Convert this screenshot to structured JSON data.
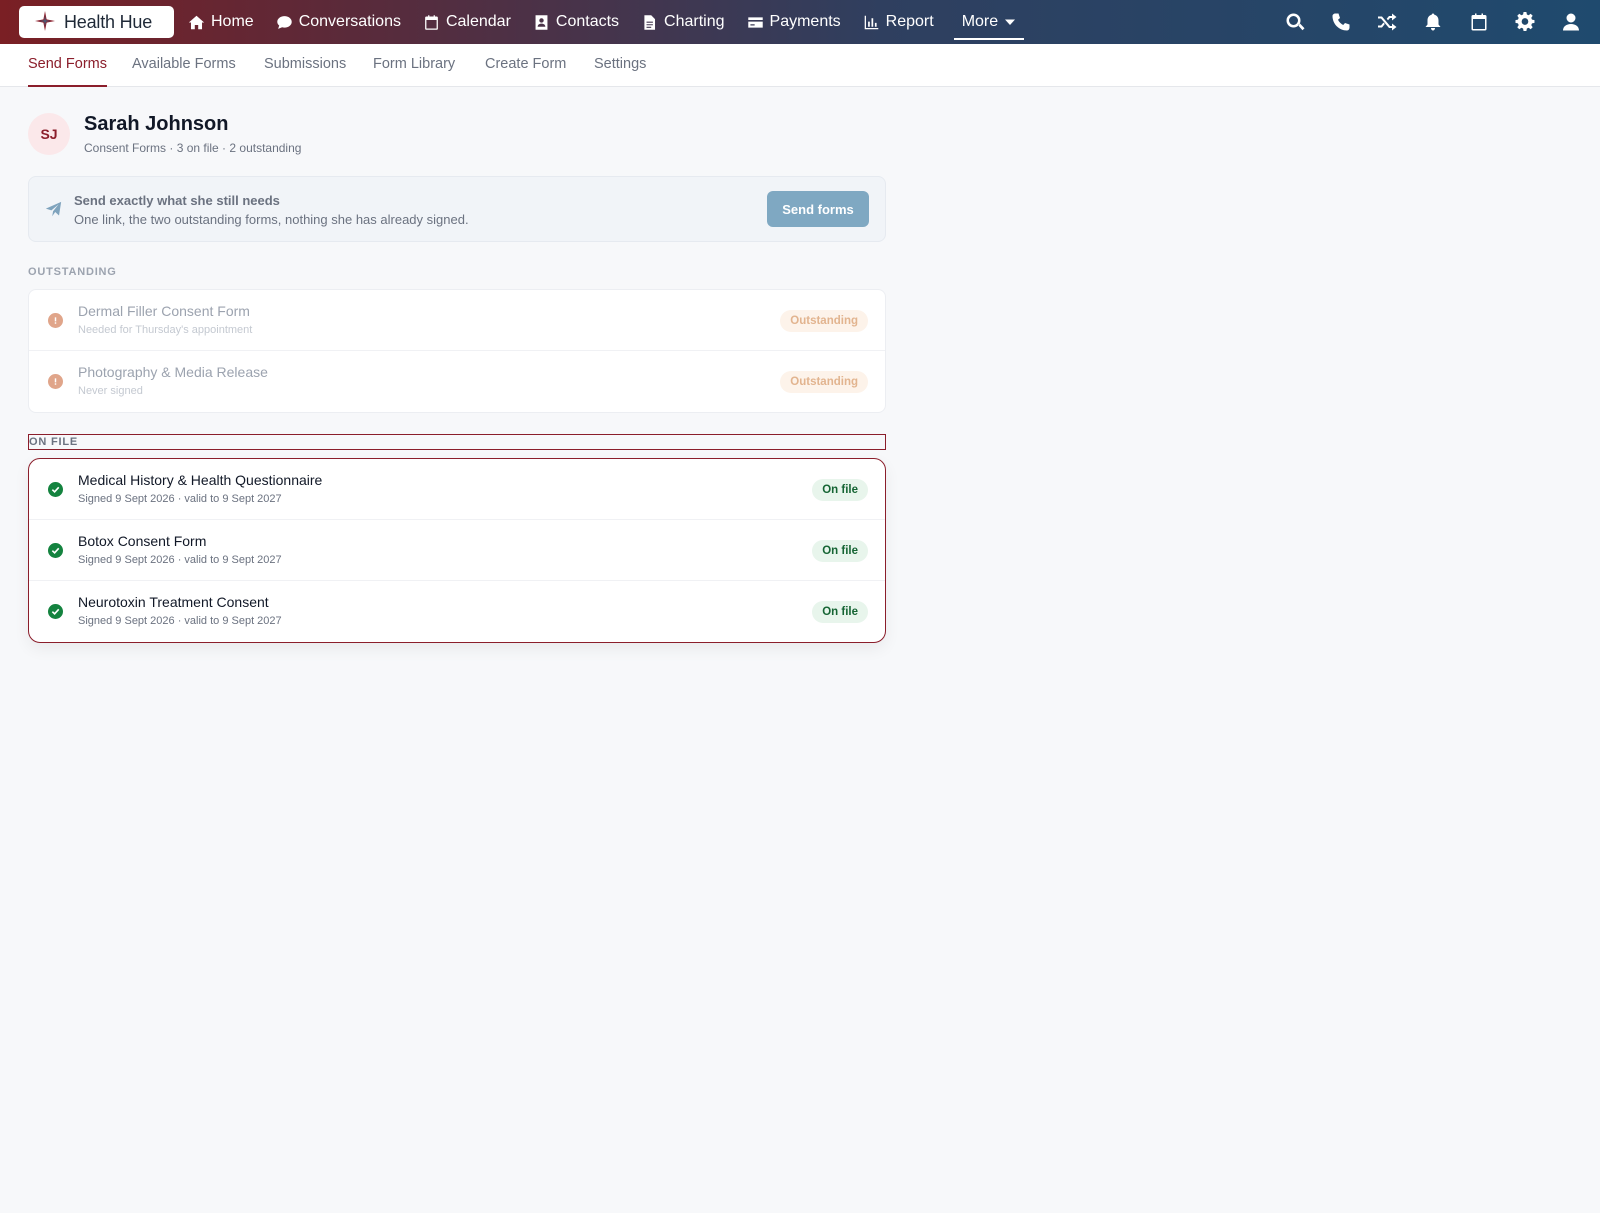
{
  "app": {
    "name": "Health Hue",
    "colors": {
      "brand": "#8b1e2b",
      "nav_start": "#7a1f24",
      "nav_end": "#1f4a6e",
      "ok": "#14833f",
      "warn": "#e0a58a"
    }
  },
  "nav": {
    "items": [
      {
        "label": "Home",
        "icon": "home-icon"
      },
      {
        "label": "Conversations",
        "icon": "chat-icon"
      },
      {
        "label": "Calendar",
        "icon": "calendar-icon"
      },
      {
        "label": "Contacts",
        "icon": "contact-card-icon"
      },
      {
        "label": "Charting",
        "icon": "document-icon"
      },
      {
        "label": "Payments",
        "icon": "credit-card-icon"
      },
      {
        "label": "Report",
        "icon": "bar-chart-icon"
      }
    ],
    "more_label": "More",
    "right_icons": [
      "search-icon",
      "phone-icon",
      "shuffle-icon",
      "bell-icon",
      "calendar-icon",
      "gear-icon",
      "user-icon"
    ]
  },
  "subtabs": {
    "items": [
      "Send Forms",
      "Available Forms",
      "Submissions",
      "Form Library",
      "Create Form",
      "Settings"
    ],
    "active": "Send Forms"
  },
  "patient": {
    "initials": "SJ",
    "name": "Sarah Johnson",
    "meta": "Consent Forms · 3 on file · 2 outstanding"
  },
  "banner": {
    "title": "Send exactly what she still needs",
    "subtitle": "One link, the two outstanding forms, nothing she has already signed.",
    "button": "Send forms"
  },
  "outstanding": {
    "label": "OUTSTANDING",
    "items": [
      {
        "title": "Dermal Filler Consent Form",
        "sub": "Needed for Thursday's appointment",
        "badge": "Outstanding"
      },
      {
        "title": "Photography & Media Release",
        "sub": "Never signed",
        "badge": "Outstanding"
      }
    ]
  },
  "on_file": {
    "label": "ON FILE",
    "items": [
      {
        "title": "Medical History & Health Questionnaire",
        "sub": "Signed 9 Sept 2026 · valid to 9 Sept 2027",
        "badge": "On file"
      },
      {
        "title": "Botox Consent Form",
        "sub": "Signed 9 Sept 2026 · valid to 9 Sept 2027",
        "badge": "On file"
      },
      {
        "title": "Neurotoxin Treatment Consent",
        "sub": "Signed 9 Sept 2026 · valid to 9 Sept 2027",
        "badge": "On file"
      }
    ]
  }
}
